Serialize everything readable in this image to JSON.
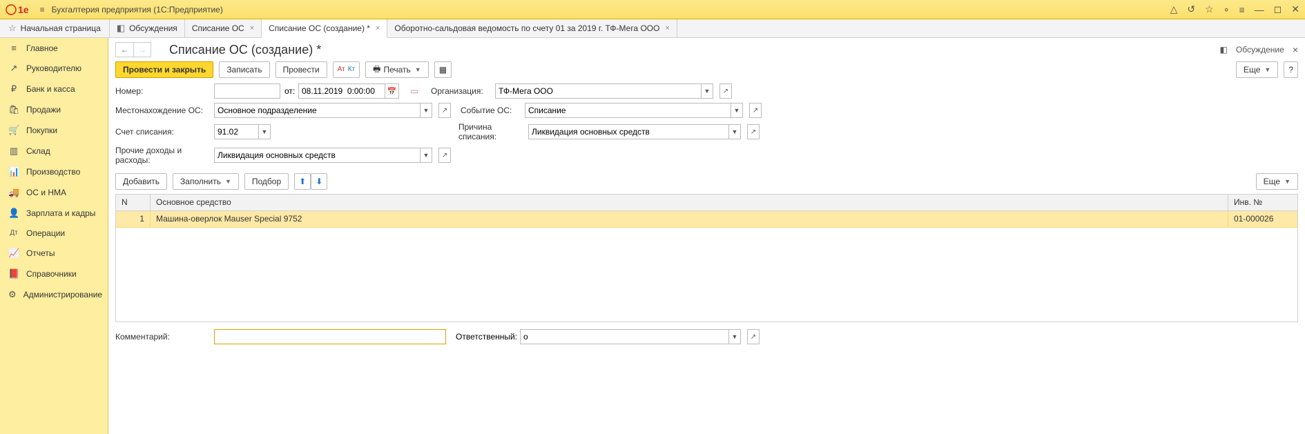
{
  "app": {
    "title": "Бухгалтерия предприятия  (1С:Предприятие)"
  },
  "titlebar_icons": {
    "bell": "△",
    "history": "↺",
    "star": "☆",
    "dot": "∘",
    "menu": "≡",
    "min": "—",
    "max": "◻",
    "close": "✕"
  },
  "tabs": {
    "home": "Начальная страница",
    "discuss": "Обсуждения",
    "t1": "Списание ОС",
    "t2": "Списание ОС (создание) *",
    "t3": "Оборотно-сальдовая ведомость по счету 01 за 2019 г. ТФ-Мега ООО"
  },
  "sidebar": [
    {
      "ico": "≡",
      "label": "Главное"
    },
    {
      "ico": "↗",
      "label": "Руководителю"
    },
    {
      "ico": "₽",
      "label": "Банк и касса"
    },
    {
      "ico": "🛍",
      "label": "Продажи"
    },
    {
      "ico": "🛒",
      "label": "Покупки"
    },
    {
      "ico": "▥",
      "label": "Склад"
    },
    {
      "ico": "📊",
      "label": "Производство"
    },
    {
      "ico": "🚚",
      "label": "ОС и НМА"
    },
    {
      "ico": "👤",
      "label": "Зарплата и кадры"
    },
    {
      "ico": "Дт",
      "label": "Операции"
    },
    {
      "ico": "📈",
      "label": "Отчеты"
    },
    {
      "ico": "📕",
      "label": "Справочники"
    },
    {
      "ico": "⚙",
      "label": "Администрирование"
    }
  ],
  "doc": {
    "title": "Списание ОС (создание) *",
    "discuss_link": "Обсуждение",
    "buttons": {
      "post_close": "Провести и закрыть",
      "record": "Записать",
      "post": "Провести",
      "print": "Печать",
      "more": "Еще",
      "help": "?"
    },
    "fields": {
      "number_lbl": "Номер:",
      "number_val": "",
      "from_lbl": "от:",
      "date_val": "08.11.2019  0:00:00",
      "org_lbl": "Организация:",
      "org_val": "ТФ-Мега ООО",
      "loc_lbl": "Местонахождение ОС:",
      "loc_val": "Основное подразделение",
      "event_lbl": "Событие ОС:",
      "event_val": "Списание",
      "acct_lbl": "Счет списания:",
      "acct_val": "91.02",
      "reason_lbl": "Причина списания:",
      "reason_val": "Ликвидация основных средств",
      "other_lbl": "Прочие доходы и расходы:",
      "other_val": "Ликвидация основных средств"
    },
    "subtoolbar": {
      "add": "Добавить",
      "fill": "Заполнить",
      "pick": "Подбор",
      "more": "Еще"
    },
    "table": {
      "cols": {
        "n": "N",
        "name": "Основное средство",
        "inv": "Инв. №"
      },
      "rows": [
        {
          "n": "1",
          "name": "Машина-оверлок Mauser Special 9752",
          "inv": "01-000026"
        }
      ]
    },
    "footer": {
      "comment_lbl": "Комментарий:",
      "comment_val": "",
      "resp_lbl": "Ответственный:",
      "resp_val": "о"
    }
  }
}
